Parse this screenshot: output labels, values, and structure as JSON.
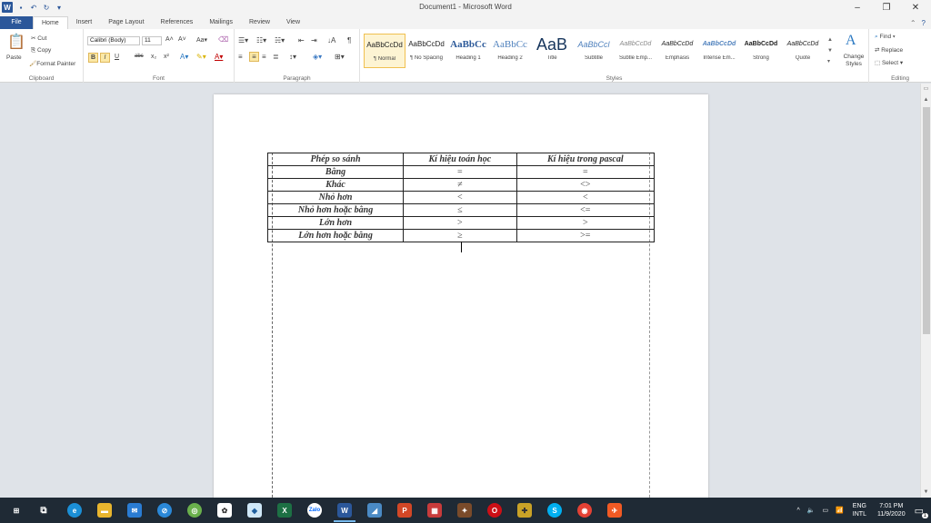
{
  "window": {
    "title": "Document1 - Microsoft Word",
    "logo": "W",
    "minimize_glyph": "–",
    "maximize_glyph": "❐",
    "close_glyph": "✕"
  },
  "tabs": [
    "File",
    "Home",
    "Insert",
    "Page Layout",
    "References",
    "Mailings",
    "Review",
    "View"
  ],
  "ribbon": {
    "clipboard": {
      "paste": "Paste",
      "cut": "Cut",
      "copy": "Copy",
      "format_painter": "Format Painter",
      "label": "Clipboard"
    },
    "font": {
      "family": "Calibri (Body)",
      "size": "11",
      "label": "Font",
      "bold": "B",
      "italic": "I",
      "underline": "U",
      "strike": "abc",
      "sub": "x₂",
      "sup": "x²"
    },
    "paragraph": {
      "label": "Paragraph"
    },
    "styles": {
      "label": "Styles",
      "items": [
        {
          "sample": "AaBbCcDd",
          "name": "¶ Normal"
        },
        {
          "sample": "AaBbCcDd",
          "name": "¶ No Spacing"
        },
        {
          "sample": "AaBbCc",
          "name": "Heading 1"
        },
        {
          "sample": "AaBbCc",
          "name": "Heading 2"
        },
        {
          "sample": "AaB",
          "name": "Title"
        },
        {
          "sample": "AaBbCcl",
          "name": "Subtitle"
        },
        {
          "sample": "AaBbCcDd",
          "name": "Subtle Emp..."
        },
        {
          "sample": "AaBbCcDd",
          "name": "Emphasis"
        },
        {
          "sample": "AaBbCcDd",
          "name": "Intense Em..."
        },
        {
          "sample": "AaBbCcDd",
          "name": "Strong"
        },
        {
          "sample": "AaBbCcDd",
          "name": "Quote"
        }
      ],
      "change_styles": "Change Styles"
    },
    "editing": {
      "find": "Find",
      "replace": "Replace",
      "select": "Select",
      "label": "Editing"
    }
  },
  "table": {
    "headers": [
      "Phép so sánh",
      "Kí hiệu toán học",
      "Kí hiệu trong pascal"
    ],
    "rows": [
      [
        "Bằng",
        "=",
        "="
      ],
      [
        "Khác",
        "≠",
        "<>"
      ],
      [
        "Nhỏ hơn",
        "<",
        "<"
      ],
      [
        "Nhỏ hơn hoặc bằng",
        "≤",
        "<="
      ],
      [
        "Lớn hơn",
        ">",
        ">"
      ],
      [
        "Lớn hơn hoặc bằng",
        "≥",
        ">="
      ]
    ]
  },
  "taskbar": {
    "apps": [
      "windows-start",
      "task-view",
      "edge",
      "file-explorer",
      "mail",
      "safari",
      "chrome-green",
      "settings",
      "ms-office",
      "excel",
      "zalo",
      "word",
      "app-blue",
      "powerpoint",
      "app-grid",
      "app-game",
      "opera",
      "app-gold",
      "skype",
      "chrome",
      "app-red"
    ],
    "lang_top": "ENG",
    "lang_bottom": "INTL",
    "time": "7:01 PM",
    "date": "11/9/2020",
    "notifications": "1"
  },
  "colors": {
    "word_blue": "#2b579a",
    "taskbar": "#1f2a35"
  }
}
